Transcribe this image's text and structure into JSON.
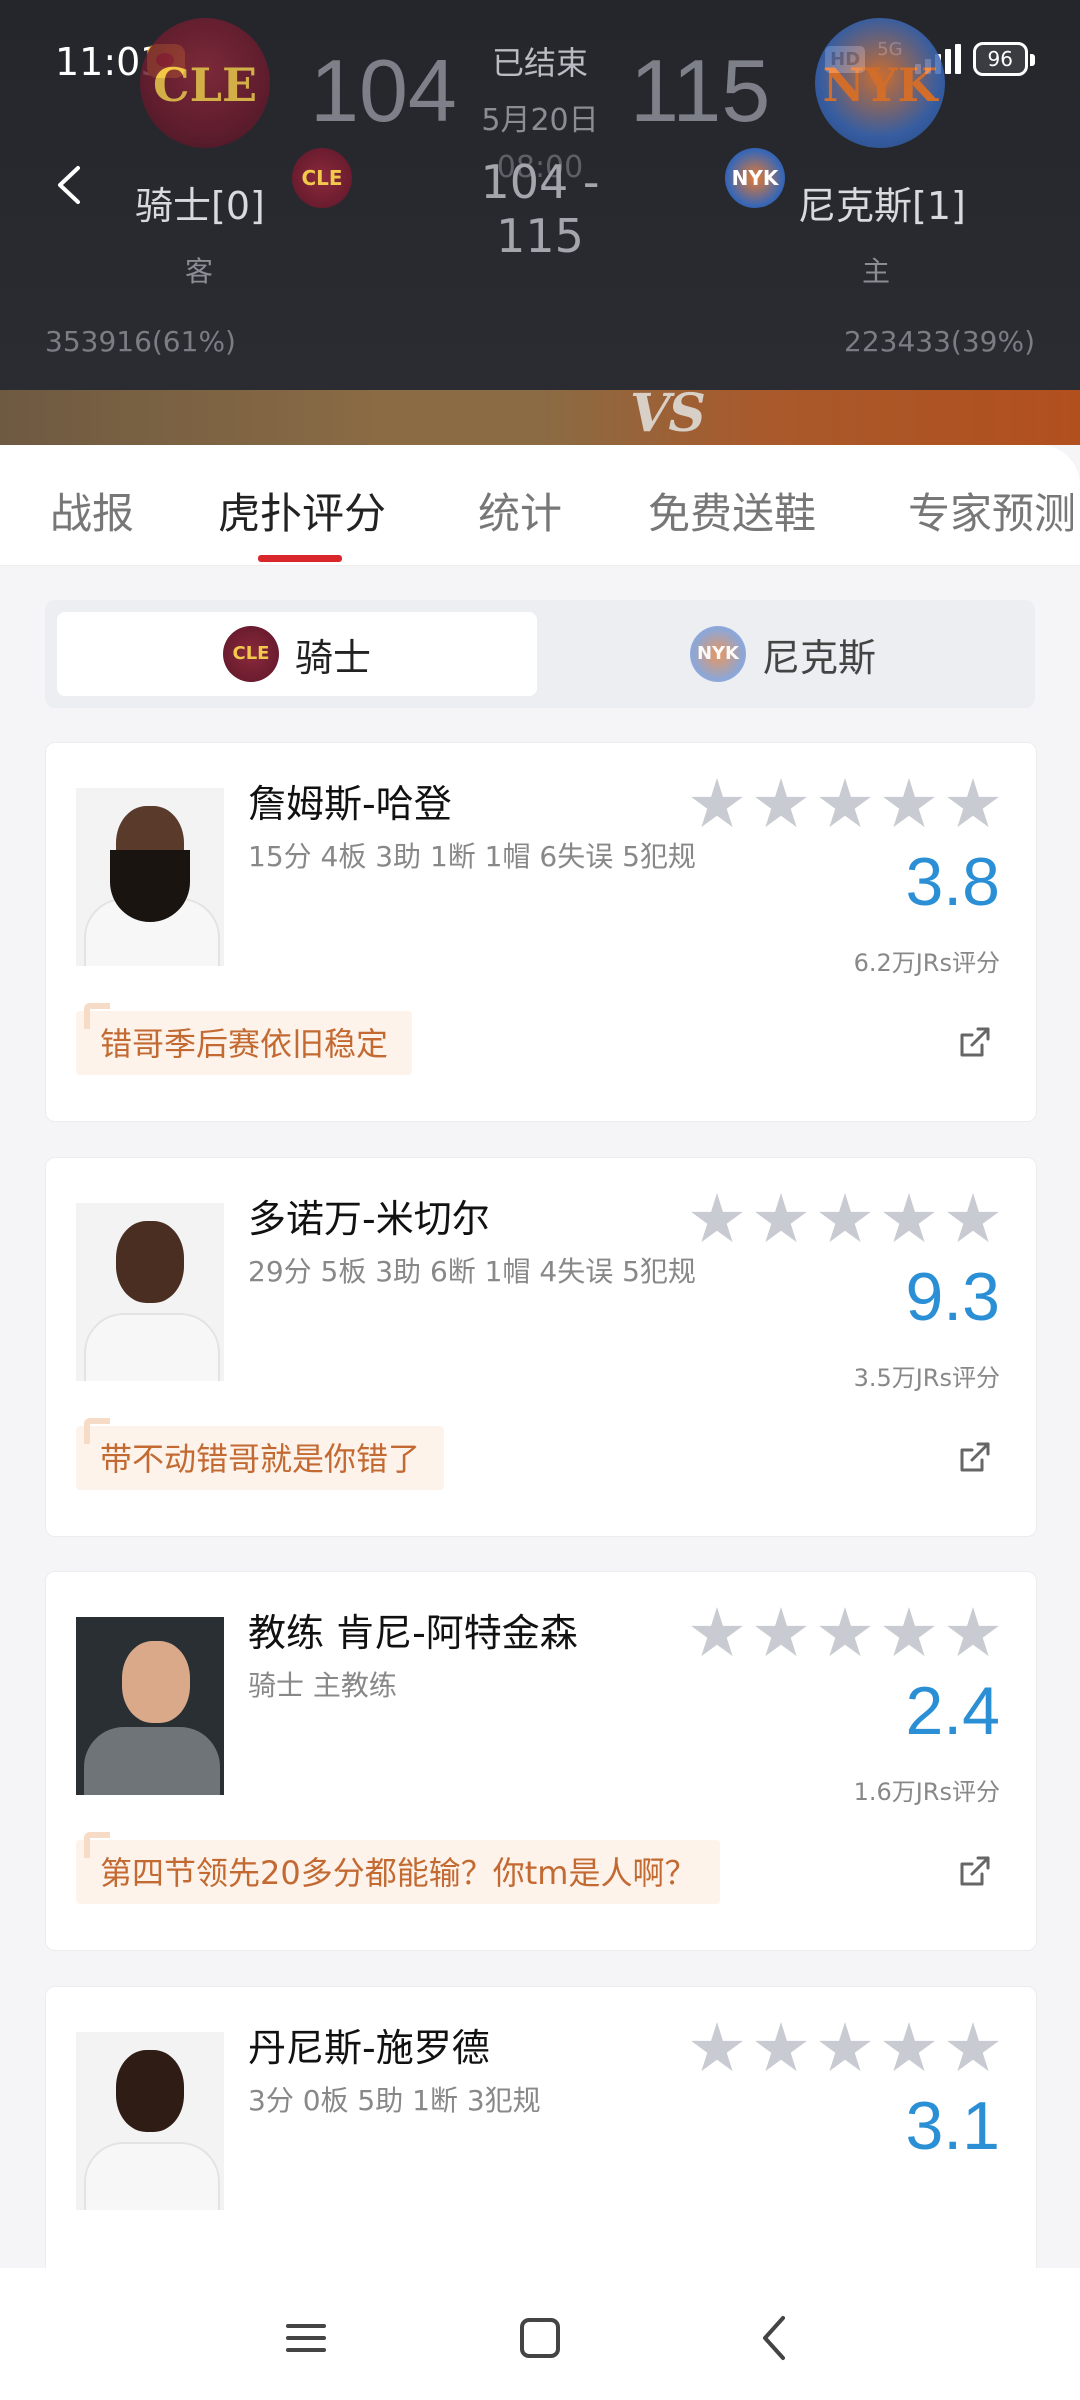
{
  "status_bar": {
    "time": "11:03",
    "hd": "HD",
    "network": "5G",
    "battery": "96"
  },
  "game": {
    "status": "已结束",
    "date": "5月20日",
    "time": "08:00",
    "away_score": "104",
    "home_score": "115",
    "score_line": "104 - 115",
    "away": {
      "abbr": "CLE",
      "name": "骑士[0]",
      "role": "客",
      "support": "353916(61%)"
    },
    "home": {
      "abbr": "NYK",
      "name": "尼克斯[1]",
      "role": "主",
      "support": "223433(39%)"
    },
    "vs": "VS"
  },
  "tabs": [
    {
      "label": "战报"
    },
    {
      "label": "虎扑评分"
    },
    {
      "label": "统计"
    },
    {
      "label": "免费送鞋"
    },
    {
      "label": "专家预测"
    }
  ],
  "team_switch": {
    "left": {
      "label": "骑士",
      "abbr": "CLE"
    },
    "right": {
      "label": "尼克斯",
      "abbr": "NYK"
    }
  },
  "players": [
    {
      "name": "詹姆斯-哈登",
      "stats": "15分 4板 3助 1断 1帽 6失误 5犯规",
      "score": "3.8",
      "votes": "6.2万JRs评分",
      "comment": "错哥季后赛依旧稳定"
    },
    {
      "name": "多诺万-米切尔",
      "stats": "29分 5板 3助 6断 1帽 4失误 5犯规",
      "score": "9.3",
      "votes": "3.5万JRs评分",
      "comment": "带不动错哥就是你错了"
    },
    {
      "name": "教练 肯尼-阿特金森",
      "stats": "骑士 主教练",
      "score": "2.4",
      "votes": "1.6万JRs评分",
      "comment": "第四节领先20多分都能输？你tm是人啊？"
    },
    {
      "name": "丹尼斯-施罗德",
      "stats": "3分 0板 5助 1断 3犯规",
      "score": "3.1",
      "votes": "",
      "comment": ""
    }
  ],
  "colors": {
    "header_bg": "#2b2d33",
    "accent_red": "#d8262b",
    "score_blue": "#2a8fd4",
    "comment_text": "#c36a33",
    "comment_bg": "#fdf3ea"
  }
}
